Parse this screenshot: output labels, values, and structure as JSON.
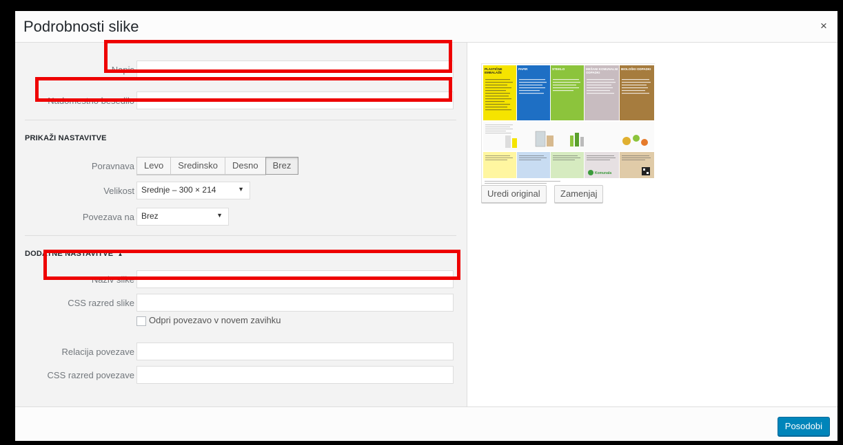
{
  "modal": {
    "title": "Podrobnosti slike",
    "close_symbol": "×"
  },
  "fields": {
    "caption_label": "Napis",
    "caption_value": "",
    "alt_label": "Nadomestno besedilo",
    "alt_value": ""
  },
  "display_settings": {
    "title": "PRIKAŽI NASTAVITVE",
    "align_label": "Poravnava",
    "align_options": [
      "Levo",
      "Sredinsko",
      "Desno",
      "Brez"
    ],
    "align_selected": "Brez",
    "size_label": "Velikost",
    "size_value": "Srednje – 300 × 214",
    "link_label": "Povezava na",
    "link_value": "Brez"
  },
  "advanced": {
    "title": "DODATNE NASTAVITVE",
    "toggle_arrow": "▲",
    "image_title_label": "Naziv slike",
    "image_css_label": "CSS razred slike",
    "new_tab_label": "Odpri povezavo v novem zavihku",
    "link_rel_label": "Relacija povezave",
    "link_css_label": "CSS razred povezave"
  },
  "preview": {
    "edit_original": "Uredi original",
    "replace": "Zamenjaj",
    "thumb_headers": [
      "PLASTIČNE EMBALAŽE",
      "PAPIR",
      "STEKLO",
      "MEŠANI KOMUNALNI ODPADKI",
      "BIOLOŠKI ODPADKI"
    ],
    "thumb_colors": [
      "#f5e400",
      "#1e6fc4",
      "#8cc43c",
      "#c8bcc0",
      "#a67c3e"
    ],
    "brand": "Komunala"
  },
  "footer": {
    "update_label": "Posodobi"
  },
  "colors": {
    "accent": "#0085ba",
    "highlight": "#ee0000"
  }
}
